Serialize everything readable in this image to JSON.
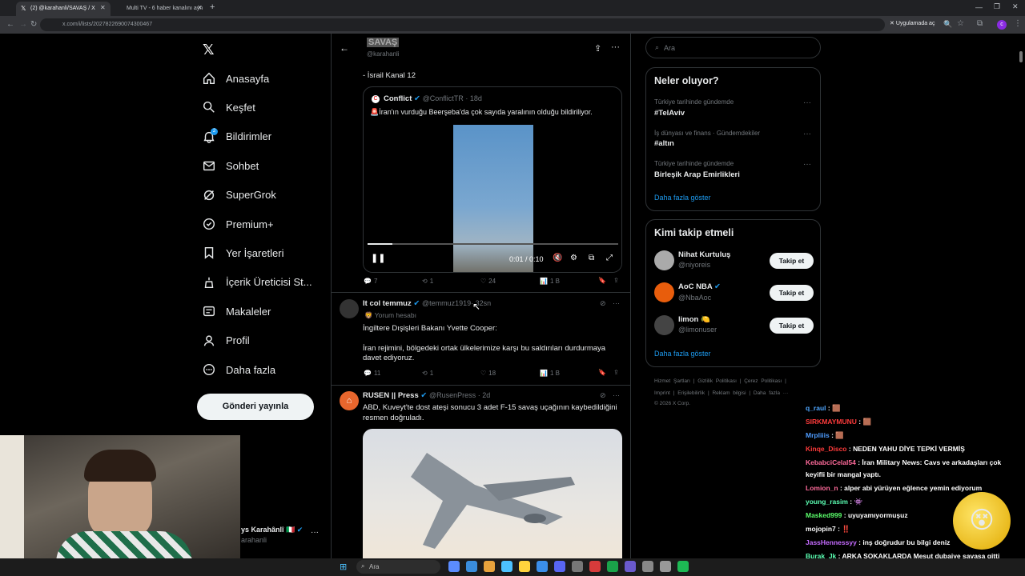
{
  "browser": {
    "tabs": [
      {
        "label": "(2) @karahanli/SAVAŞ / X",
        "active": true
      },
      {
        "label": "Multi TV - 6 haber kanalını ayn",
        "active": false
      }
    ],
    "url": "x.com/i/lists/2027822690074300467",
    "open_app_label": "Uygulamada aç",
    "profile_initial": "c"
  },
  "sidebar": {
    "items": [
      {
        "label": "Anasayfa",
        "icon": "home-icon"
      },
      {
        "label": "Keşfet",
        "icon": "search-icon"
      },
      {
        "label": "Bildirimler",
        "icon": "bell-icon"
      },
      {
        "label": "Sohbet",
        "icon": "mail-icon"
      },
      {
        "label": "SuperGrok",
        "icon": "grok-icon"
      },
      {
        "label": "Premium+",
        "icon": "premium-icon"
      },
      {
        "label": "Yer İşaretleri",
        "icon": "bookmark-icon"
      },
      {
        "label": "İçerik Üreticisi St...",
        "icon": "creator-studio-icon"
      },
      {
        "label": "Makaleler",
        "icon": "articles-icon"
      },
      {
        "label": "Profil",
        "icon": "profile-icon"
      },
      {
        "label": "Daha fazla",
        "icon": "more-circle-icon"
      }
    ],
    "notification_count": "2",
    "post_button": "Gönderi yayınla",
    "account_name": "ys Karahânlî",
    "account_handle": "arahanli"
  },
  "header": {
    "title": "SAVAŞ",
    "handle": "@karahanli"
  },
  "tweets": [
    {
      "fragment_text": "- İsrail Kanal 12",
      "quote": {
        "name": "Conflict",
        "handle": "@ConflictTR",
        "time": "· 18d",
        "text": "🚨İran'ın vurduğu Beerşeba'da çok sayıda yaralının olduğu bildiriliyor.",
        "video_time": "0:01 / 0:10",
        "video_progress": 0.1
      },
      "actions": {
        "replies": "7",
        "reposts": "1",
        "likes": "24",
        "views": "1 B"
      }
    },
    {
      "name": "It col temmuz",
      "handle": "@temmuz1919",
      "time": "· 32sn",
      "subtitle": "Yorum hesabı",
      "line1": "İngiltere Dışişleri Bakanı Yvette Cooper:",
      "line2": "İran rejimini, bölgedeki ortak ülkelerimize karşı bu saldırıları durdurmaya",
      "line3": "davet ediyoruz.",
      "actions": {
        "replies": "11",
        "reposts": "1",
        "likes": "18",
        "views": "1 B"
      }
    },
    {
      "name": "RUSEN || Press",
      "handle": "@RusenPress",
      "time": "· 2d",
      "line1": "ABD, Kuveyt'te dost ateşi sonucu 3 adet F-15 savaş uçağının kaybedildiğini",
      "line2": "resmen doğruladı."
    }
  ],
  "search": {
    "placeholder": "Ara"
  },
  "trends": {
    "title": "Neler oluyor?",
    "items": [
      {
        "meta": "Türkiye tarihinde gündemde",
        "name": "#TelAviv"
      },
      {
        "meta": "İş dünyası ve finans · Gündemdekiler",
        "name": "#altın"
      },
      {
        "meta": "Türkiye tarihinde gündemde",
        "name": "Birleşik Arap Emirlikleri"
      }
    ],
    "show_more": "Daha fazla göster"
  },
  "who_to_follow": {
    "title": "Kimi takip etmeli",
    "items": [
      {
        "name": "Nihat Kurtuluş",
        "handle": "@niyoreis",
        "button": "Takip et"
      },
      {
        "name": "AoC NBA",
        "handle": "@NbaAoc",
        "button": "Takip et"
      },
      {
        "name": "limon 🍋",
        "handle": "@limonuser",
        "button": "Takip et"
      }
    ],
    "show_more": "Daha fazla göster"
  },
  "footer": {
    "row1": [
      "Hizmet Şartları",
      "Gizlilik Politikası",
      "Çerez Politikası"
    ],
    "row2": [
      "Imprint",
      "Erişilebilirlik",
      "Reklam bilgisi",
      "Daha fazla ···"
    ],
    "copyright": "© 2026 X Corp."
  },
  "chat": [
    {
      "user": "q_raul",
      "color": "#4ea6ff",
      "msg": ": 🟫"
    },
    {
      "user": "SIRKMAYMUNU",
      "color": "#ff3b3b",
      "msg": ": 🟫"
    },
    {
      "user": "Mrpliiis",
      "color": "#4e9cff",
      "msg": ": 🟫"
    },
    {
      "user": "Kinqe_Disco",
      "color": "#ff3b3b",
      "msg": ": NEDEN YAHU DİYE TEPKİ VERMİŞ"
    },
    {
      "user": "KebabciCelal54",
      "color": "#ff6b9b",
      "msg": ": İran Military News: Cavs ve arkadaşları çok"
    },
    {
      "user": "",
      "color": "#fff",
      "msg": "keyifli bir mangal yaptı."
    },
    {
      "user": "Lomion_n",
      "color": "#ff6b9b",
      "msg": ": alper abi yürüyen eğlence yemin ediyorum"
    },
    {
      "user": "young_rasim",
      "color": "#5bffb3",
      "msg": ": 👾"
    },
    {
      "user": "Masked999",
      "color": "#5bff6b",
      "msg": ": uyuyamıyormuşuz"
    },
    {
      "user": "mojopin7",
      "color": "#ffffff",
      "msg": ": ‼️"
    },
    {
      "user": "JassHennessyy",
      "color": "#c56bff",
      "msg": ": inş doğrudur bu bilgi deniz"
    },
    {
      "user": "Burak_Jk",
      "color": "#5bffb3",
      "msg": ": ARKA SOKAKLARDA Mesut dubaiye savaşa gitti"
    },
    {
      "user": "",
      "color": "#fff",
      "msg": "yapacaklar kesin"
    }
  ],
  "taskbar": {
    "search_placeholder": "Ara"
  },
  "colors": {
    "accent": "#1d9bf0",
    "background": "#000000",
    "border": "#2f3336"
  }
}
